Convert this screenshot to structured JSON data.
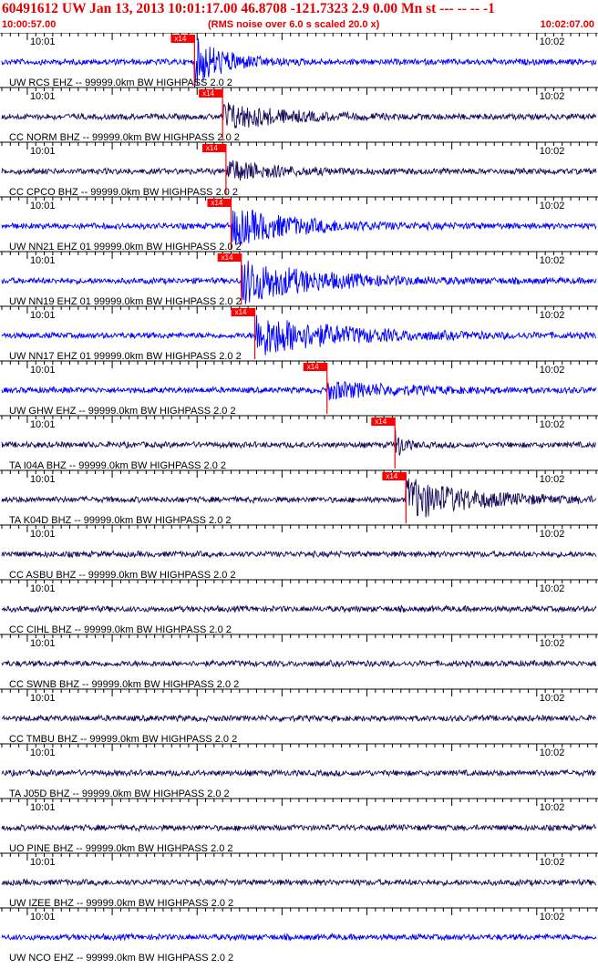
{
  "header": {
    "title": "60491612 UW Jan 13, 2013 10:01:17.00   46.8708 -121.7323  2.9 0.00 Mn st --- -- --   -1",
    "start_time": "10:00:57.00",
    "rms_note": "(RMS noise over 6.0 s scaled 20.0 x)",
    "end_time": "10:02:07.00"
  },
  "colors": {
    "header_text": "#e00000",
    "trace_blue": "#0000ff",
    "trace_navy": "#1a0a5a",
    "pick_marker": "#ff0000",
    "axis": "#000000"
  },
  "chart_data": {
    "type": "line",
    "x_unit": "time (UTC)",
    "x_range": [
      "10:00:57.00",
      "10:02:07.00"
    ],
    "time_labels": [
      "10:01",
      "10:02"
    ],
    "origin_time": "10:01:17.00",
    "scale_note": "RMS noise over 6.0 s scaled 20.0 x",
    "traces": [
      {
        "label": "UW RCS EHZ -- 99999.0km BW  HIGHPASS  2.0  2",
        "color": "#0000ff",
        "pick": "x14",
        "onset_s": 22.7,
        "peak_amp": 1.0,
        "coda_s": 8
      },
      {
        "label": "CC NORM BHZ -- 99999.0km BW  HIGHPASS  2.0  2",
        "color": "#1a0a5a",
        "pick": "x14",
        "onset_s": 26.0,
        "peak_amp": 0.6,
        "coda_s": 14
      },
      {
        "label": "CC CPCO BHZ -- 99999.0km BW  HIGHPASS  2.0  2",
        "color": "#1a0a5a",
        "pick": "x14",
        "onset_s": 26.4,
        "peak_amp": 0.45,
        "coda_s": 12
      },
      {
        "label": "UW NN21 EHZ 01 99999.0km BW  HIGHPASS  2.0  2",
        "color": "#0000ff",
        "pick": "x14",
        "onset_s": 27.0,
        "peak_amp": 0.8,
        "coda_s": 16
      },
      {
        "label": "UW NN19 EHZ 01 99999.0km BW  HIGHPASS  2.0  2",
        "color": "#0000ff",
        "pick": "x14",
        "onset_s": 28.2,
        "peak_amp": 0.95,
        "coda_s": 18
      },
      {
        "label": "UW NN17 EHZ 01 99999.0km BW  HIGHPASS  2.0  2",
        "color": "#0000ff",
        "pick": "x14",
        "onset_s": 29.8,
        "peak_amp": 0.9,
        "coda_s": 20
      },
      {
        "label": "UW GHW EHZ -- 99999.0km BW  HIGHPASS  2.0  2",
        "color": "#0000ff",
        "pick": "x14",
        "onset_s": 38.3,
        "peak_amp": 0.35,
        "coda_s": 18
      },
      {
        "label": "TA I04A BHZ -- 99999.0km BW  HIGHPASS  2.0  2",
        "color": "#1a0a5a",
        "pick": "x14",
        "onset_s": 46.3,
        "peak_amp": 0.7,
        "coda_s": 2
      },
      {
        "label": "TA K04D BHZ -- 99999.0km BW  HIGHPASS  2.0  2",
        "color": "#1a0a5a",
        "pick": "x14",
        "onset_s": 47.6,
        "peak_amp": 0.9,
        "coda_s": 16
      },
      {
        "label": "CC ASBU BHZ -- 99999.0km BW  HIGHPASS  2.0  2",
        "color": "#1a0a5a",
        "pick": null,
        "onset_s": null,
        "peak_amp": 0,
        "coda_s": 0
      },
      {
        "label": "CC CIHL BHZ -- 99999.0km BW  HIGHPASS  2.0  2",
        "color": "#1a0a5a",
        "pick": null,
        "onset_s": null,
        "peak_amp": 0,
        "coda_s": 0
      },
      {
        "label": "CC SWNB BHZ -- 99999.0km BW  HIGHPASS  2.0  2",
        "color": "#1a0a5a",
        "pick": null,
        "onset_s": null,
        "peak_amp": 0,
        "coda_s": 0
      },
      {
        "label": "CC TMBU BHZ -- 99999.0km BW  HIGHPASS  2.0  2",
        "color": "#1a0a5a",
        "pick": null,
        "onset_s": null,
        "peak_amp": 0,
        "coda_s": 0
      },
      {
        "label": "TA J05D BHZ -- 99999.0km BW  HIGHPASS  2.0  2",
        "color": "#1a0a5a",
        "pick": null,
        "onset_s": null,
        "peak_amp": 0,
        "coda_s": 0
      },
      {
        "label": "UO PINE BHZ -- 99999.0km BW  HIGHPASS  2.0  2",
        "color": "#1a0a5a",
        "pick": null,
        "onset_s": null,
        "peak_amp": 0,
        "coda_s": 0
      },
      {
        "label": "UW IZEE BHZ -- 99999.0km BW  HIGHPASS  2.0  2",
        "color": "#1a0a5a",
        "pick": null,
        "onset_s": null,
        "peak_amp": 0,
        "coda_s": 0
      },
      {
        "label": "UW NCO EHZ -- 99999.0km BW  HIGHPASS  2.0  2",
        "color": "#0000ff",
        "pick": null,
        "onset_s": null,
        "peak_amp": 0,
        "coda_s": 0
      }
    ]
  }
}
